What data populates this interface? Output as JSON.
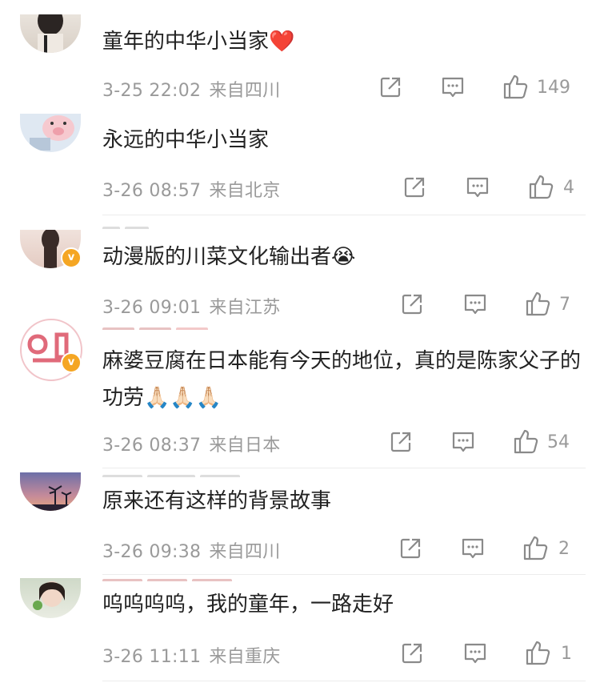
{
  "comments": [
    {
      "text": "童年的中华小当家❤️",
      "time": "3-25 22:02",
      "location": "来自四川",
      "likes": "149",
      "verified": false
    },
    {
      "text": "永远的中华小当家",
      "time": "3-26 08:57",
      "location": "来自北京",
      "likes": "4",
      "verified": false
    },
    {
      "text": "动漫版的川菜文化输出者😭",
      "time": "3-26 09:01",
      "location": "来自江苏",
      "likes": "7",
      "verified": true
    },
    {
      "text": "麻婆豆腐在日本能有今天的地位，真的是陈家父子的功劳🙏🏻🙏🏻🙏🏻",
      "time": "3-26 08:37",
      "location": "来自日本",
      "likes": "54",
      "verified": true
    },
    {
      "text": "原来还有这样的背景故事",
      "time": "3-26 09:38",
      "location": "来自四川",
      "likes": "2",
      "verified": false
    },
    {
      "text": "呜呜呜呜，我的童年，一路走好",
      "time": "3-26 11:11",
      "location": "来自重庆",
      "likes": "1",
      "verified": false
    }
  ],
  "icons": {
    "share": "share-icon",
    "comment": "comment-icon",
    "like": "like-icon",
    "verified_badge": "v",
    "colors": {
      "meta": "#9a9a9a",
      "text": "#222222",
      "badge": "#f5a623"
    }
  }
}
